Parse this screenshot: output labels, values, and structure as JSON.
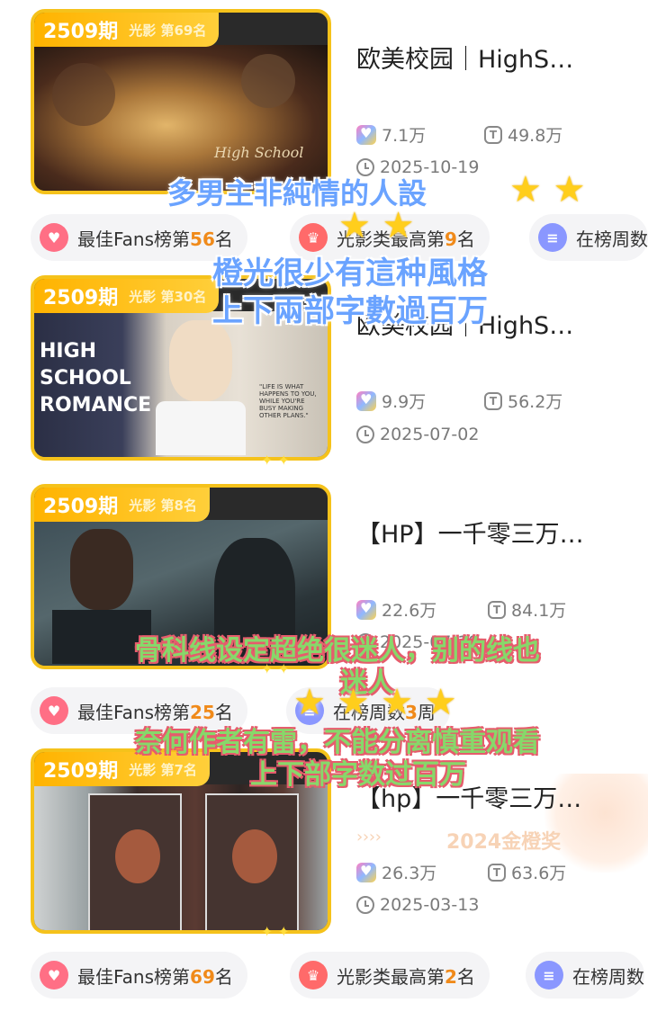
{
  "cards": [
    {
      "issue": "2509期",
      "rank": "光影 第69名",
      "title": "欧美校园｜HighS…",
      "likes": "7.1万",
      "reads": "49.8万",
      "date": "2025-10-19",
      "pills": [
        {
          "pre": "最佳Fans榜第",
          "num": "56",
          "post": "名"
        },
        {
          "pre": "光影类最高第",
          "num": "9",
          "post": "名"
        },
        {
          "pre": "在榜周数",
          "num": "",
          "post": ""
        }
      ]
    },
    {
      "issue": "2509期",
      "rank": "光影 第30名",
      "title": "欧美校园｜HighS…",
      "likes": "9.9万",
      "reads": "56.2万",
      "date": "2025-07-02",
      "cover_text": "HIGH SCHOOL ROMANCE",
      "cover_quote": "\"LIFE IS WHAT HAPPENS TO YOU, WHILE YOU'RE BUSY MAKING OTHER PLANS.\""
    },
    {
      "issue": "2509期",
      "rank": "光影 第8名",
      "title": "【HP】一千零三万…",
      "likes": "22.6万",
      "reads": "84.1万",
      "date": "2025-07-19",
      "pills": [
        {
          "pre": "最佳Fans榜第",
          "num": "25",
          "post": "名"
        },
        {
          "pre": "在榜周数",
          "num": "3",
          "post": "周"
        }
      ]
    },
    {
      "issue": "2509期",
      "rank": "光影 第7名",
      "title": "【hp】一千零三万…",
      "likes": "26.3万",
      "reads": "63.6万",
      "date": "2025-03-13",
      "pills": [
        {
          "pre": "最佳Fans榜第",
          "num": "69",
          "post": "名"
        },
        {
          "pre": "光影类最高第",
          "num": "2",
          "post": "名"
        },
        {
          "pre": "在榜周数",
          "num": "",
          "post": ""
        }
      ]
    }
  ],
  "watermark": "2024金橙奖",
  "overlay_notes": {
    "note1_line1": "多男主非純情的人設",
    "note1_line2": "橙光很少有這种風格",
    "note1_line3": "上下兩部字數過百万",
    "note2_line1": "骨科线设定超绝很迷人，别的线也",
    "note2_line2": "迷人",
    "note2_line3": "奈何作者有雷，不能分离慎重观看",
    "note2_line4": "上下部字数过百万"
  },
  "stars_row1": "★ ★",
  "stars_row2": "★ ★",
  "stars_row3": "★ ★ ★ ★",
  "colors": {
    "accent": "#f5c21b",
    "number": "#f08a1a",
    "note_blue": "#6aa3ff",
    "note_green": "#87d86a",
    "note_outline": "#e65c6c"
  }
}
